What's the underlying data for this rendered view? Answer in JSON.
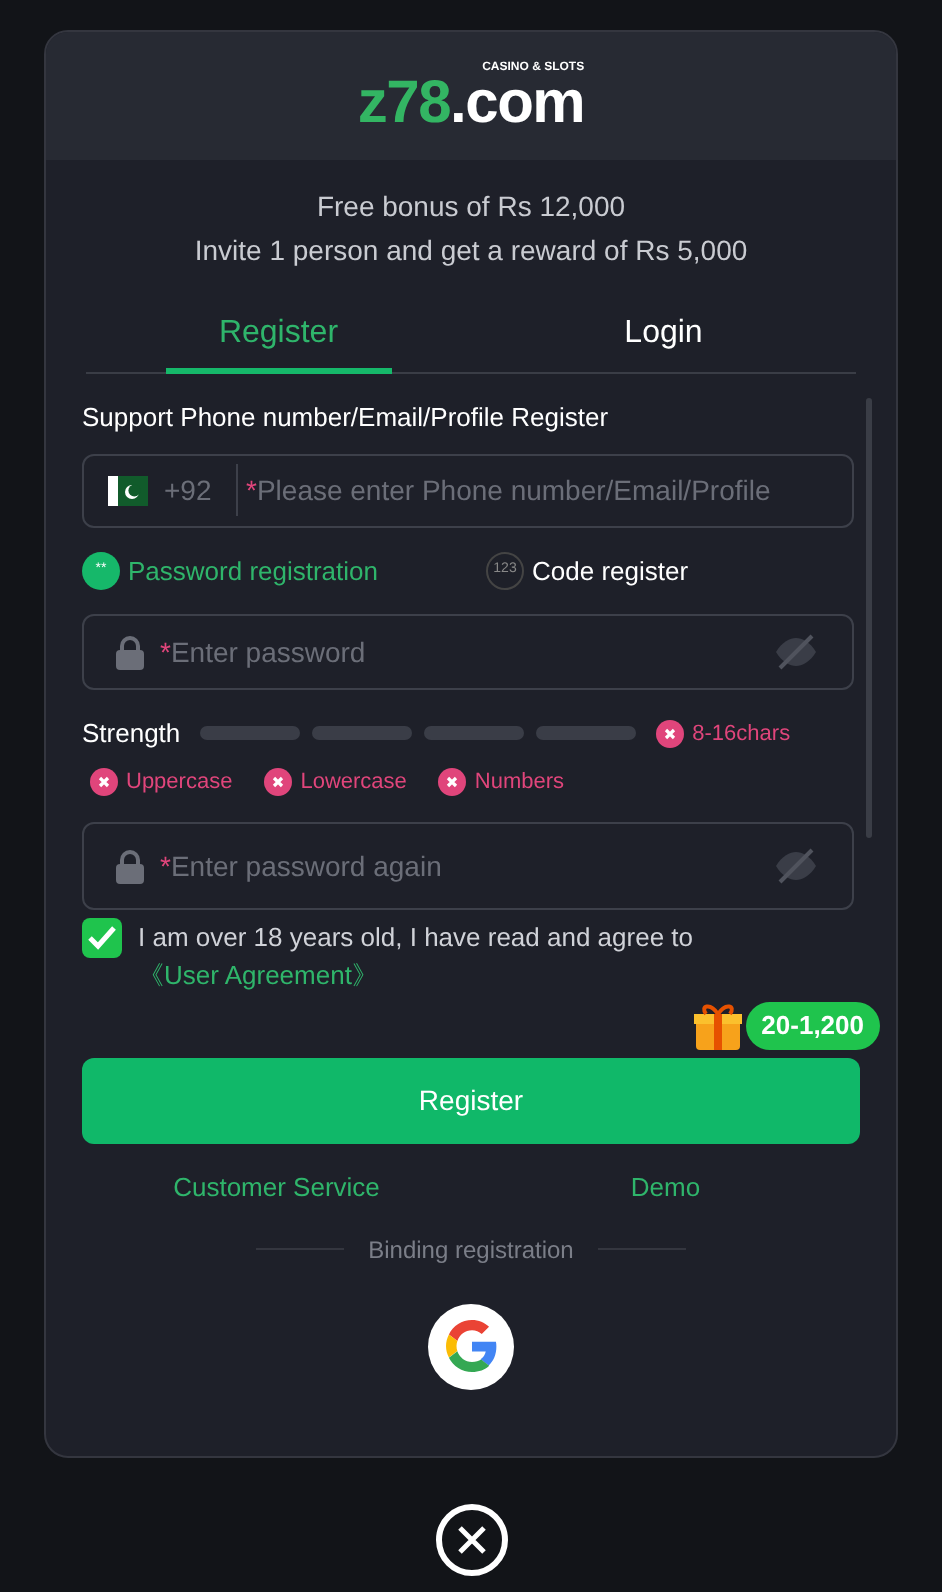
{
  "logo": {
    "main": "z78",
    "suffix": ".com",
    "tagline": "CASINO & SLOTS"
  },
  "bonus_lines": [
    "Free bonus of Rs 12,000",
    "Invite 1 person and get a reward of Rs 5,000"
  ],
  "tabs": [
    {
      "label": "Register",
      "selected": true
    },
    {
      "label": "Login",
      "selected": false
    }
  ],
  "form": {
    "heading": "Support Phone number/Email/Profile Register",
    "country_code": "+92",
    "account_field": {
      "placeholder": "Please enter Phone number/Email/Profile",
      "required_mark": "*"
    },
    "methods": [
      {
        "label": "Password registration",
        "icon": "**",
        "selected": true
      },
      {
        "label": "Code register",
        "icon": "123",
        "selected": false
      }
    ],
    "password_field": {
      "placeholder": "Enter password",
      "required_mark": "*"
    },
    "strength": {
      "label": "Strength"
    },
    "rules": [
      {
        "label": "8-16chars",
        "met": false
      },
      {
        "label": "Uppercase",
        "met": false
      },
      {
        "label": "Lowercase",
        "met": false
      },
      {
        "label": "Numbers",
        "met": false
      }
    ],
    "confirm_field": {
      "placeholder": "Enter password again",
      "required_mark": "*"
    }
  },
  "agreement": {
    "checked": true,
    "text": "I am over 18 years old, I have read and agree to",
    "link": "《User Agreement》"
  },
  "reward_badge": "20-1,200",
  "register_button": "Register",
  "links": [
    "Customer Service",
    "Demo"
  ],
  "binding_label": "Binding registration"
}
